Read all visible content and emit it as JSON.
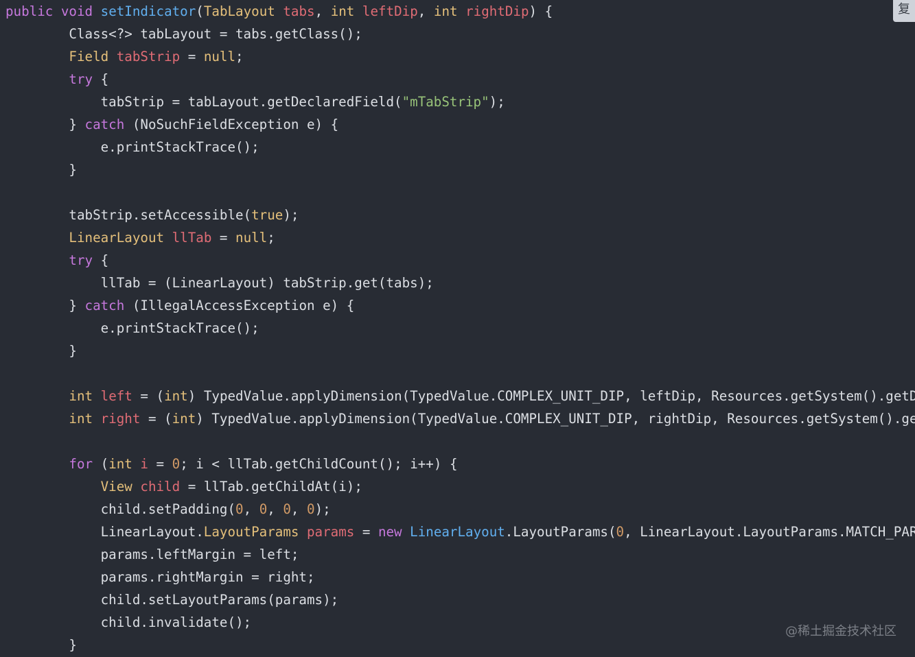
{
  "copy_button": {
    "label": "复"
  },
  "watermark": "@稀土掘金技术社区",
  "colors": {
    "background": "#282c34",
    "plain": "#dcdfe4",
    "keyword": "#c678dd",
    "type": "#e5c07b",
    "variable": "#e06c75",
    "function": "#61afef",
    "string": "#98c379",
    "number": "#d19a66"
  },
  "code_lines": [
    [
      [
        "kw",
        "public"
      ],
      [
        "p",
        " "
      ],
      [
        "kw",
        "void"
      ],
      [
        "p",
        " "
      ],
      [
        "fn",
        "setIndicator"
      ],
      [
        "p",
        "("
      ],
      [
        "type",
        "TabLayout"
      ],
      [
        "p",
        " "
      ],
      [
        "var",
        "tabs"
      ],
      [
        "p",
        ", "
      ],
      [
        "type",
        "int"
      ],
      [
        "p",
        " "
      ],
      [
        "var",
        "leftDip"
      ],
      [
        "p",
        ", "
      ],
      [
        "type",
        "int"
      ],
      [
        "p",
        " "
      ],
      [
        "var",
        "rightDip"
      ],
      [
        "p",
        ") {"
      ]
    ],
    [
      [
        "p",
        "        Class<?> tabLayout = tabs.getClass();"
      ]
    ],
    [
      [
        "p",
        "        "
      ],
      [
        "type",
        "Field"
      ],
      [
        "p",
        " "
      ],
      [
        "var",
        "tabStrip"
      ],
      [
        "p",
        " = "
      ],
      [
        "type",
        "null"
      ],
      [
        "p",
        ";"
      ]
    ],
    [
      [
        "p",
        "        "
      ],
      [
        "kw",
        "try"
      ],
      [
        "p",
        " {"
      ]
    ],
    [
      [
        "p",
        "            tabStrip = tabLayout.getDeclaredField("
      ],
      [
        "str",
        "\"mTabStrip\""
      ],
      [
        "p",
        ");"
      ]
    ],
    [
      [
        "p",
        "        } "
      ],
      [
        "kw",
        "catch"
      ],
      [
        "p",
        " (NoSuchFieldException e) {"
      ]
    ],
    [
      [
        "p",
        "            e.printStackTrace();"
      ]
    ],
    [
      [
        "p",
        "        }"
      ]
    ],
    [
      [
        "p",
        ""
      ]
    ],
    [
      [
        "p",
        "        tabStrip.setAccessible("
      ],
      [
        "type",
        "true"
      ],
      [
        "p",
        ");"
      ]
    ],
    [
      [
        "p",
        "        "
      ],
      [
        "type",
        "LinearLayout"
      ],
      [
        "p",
        " "
      ],
      [
        "var",
        "llTab"
      ],
      [
        "p",
        " = "
      ],
      [
        "type",
        "null"
      ],
      [
        "p",
        ";"
      ]
    ],
    [
      [
        "p",
        "        "
      ],
      [
        "kw",
        "try"
      ],
      [
        "p",
        " {"
      ]
    ],
    [
      [
        "p",
        "            llTab = (LinearLayout) tabStrip.get(tabs);"
      ]
    ],
    [
      [
        "p",
        "        } "
      ],
      [
        "kw",
        "catch"
      ],
      [
        "p",
        " (IllegalAccessException e) {"
      ]
    ],
    [
      [
        "p",
        "            e.printStackTrace();"
      ]
    ],
    [
      [
        "p",
        "        }"
      ]
    ],
    [
      [
        "p",
        ""
      ]
    ],
    [
      [
        "p",
        "        "
      ],
      [
        "type",
        "int"
      ],
      [
        "p",
        " "
      ],
      [
        "var",
        "left"
      ],
      [
        "p",
        " = ("
      ],
      [
        "type",
        "int"
      ],
      [
        "p",
        ") TypedValue.applyDimension(TypedValue.COMPLEX_UNIT_DIP, leftDip, Resources.getSystem().getD"
      ]
    ],
    [
      [
        "p",
        "        "
      ],
      [
        "type",
        "int"
      ],
      [
        "p",
        " "
      ],
      [
        "var",
        "right"
      ],
      [
        "p",
        " = ("
      ],
      [
        "type",
        "int"
      ],
      [
        "p",
        ") TypedValue.applyDimension(TypedValue.COMPLEX_UNIT_DIP, rightDip, Resources.getSystem().ge"
      ]
    ],
    [
      [
        "p",
        ""
      ]
    ],
    [
      [
        "p",
        "        "
      ],
      [
        "kw",
        "for"
      ],
      [
        "p",
        " ("
      ],
      [
        "type",
        "int"
      ],
      [
        "p",
        " "
      ],
      [
        "var",
        "i"
      ],
      [
        "p",
        " = "
      ],
      [
        "num",
        "0"
      ],
      [
        "p",
        "; i < llTab.getChildCount(); i++) {"
      ]
    ],
    [
      [
        "p",
        "            "
      ],
      [
        "type",
        "View"
      ],
      [
        "p",
        " "
      ],
      [
        "var",
        "child"
      ],
      [
        "p",
        " = llTab.getChildAt(i);"
      ]
    ],
    [
      [
        "p",
        "            child.setPadding("
      ],
      [
        "num",
        "0"
      ],
      [
        "p",
        ", "
      ],
      [
        "num",
        "0"
      ],
      [
        "p",
        ", "
      ],
      [
        "num",
        "0"
      ],
      [
        "p",
        ", "
      ],
      [
        "num",
        "0"
      ],
      [
        "p",
        ");"
      ]
    ],
    [
      [
        "p",
        "            LinearLayout."
      ],
      [
        "type",
        "LayoutParams"
      ],
      [
        "p",
        " "
      ],
      [
        "var",
        "params"
      ],
      [
        "p",
        " = "
      ],
      [
        "kw",
        "new"
      ],
      [
        "p",
        " "
      ],
      [
        "fn",
        "LinearLayout"
      ],
      [
        "p",
        ".LayoutParams("
      ],
      [
        "num",
        "0"
      ],
      [
        "p",
        ", LinearLayout.LayoutParams.MATCH_PAR"
      ]
    ],
    [
      [
        "p",
        "            params.leftMargin = left;"
      ]
    ],
    [
      [
        "p",
        "            params.rightMargin = right;"
      ]
    ],
    [
      [
        "p",
        "            child.setLayoutParams(params);"
      ]
    ],
    [
      [
        "p",
        "            child.invalidate();"
      ]
    ],
    [
      [
        "p",
        "        }"
      ]
    ]
  ]
}
